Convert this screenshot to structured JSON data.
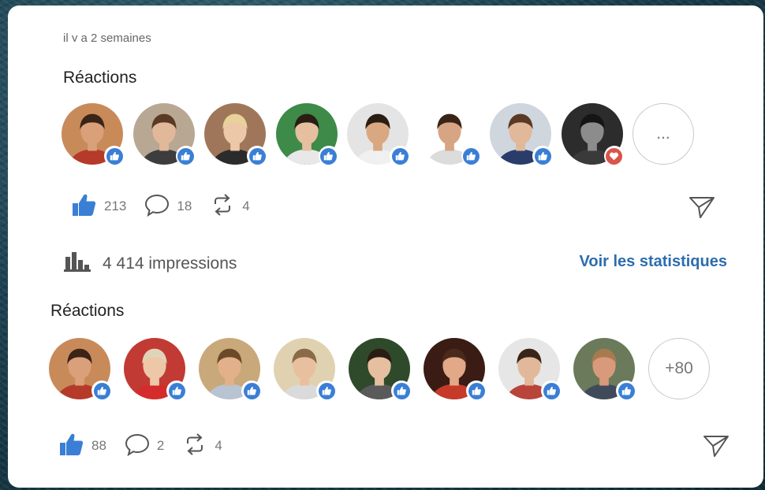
{
  "post1": {
    "timestamp": "il y a 2 semaines",
    "reactions_title": "Réactions",
    "avatars": [
      {
        "name": "avatar-1",
        "badge": "like",
        "bg": "#c98a5a",
        "skin": "#d9a07a",
        "hair": "#3a2418",
        "shirt": "#b53a2a"
      },
      {
        "name": "avatar-2",
        "badge": "like",
        "bg": "#b8a893",
        "skin": "#e2b89a",
        "hair": "#5a3a24",
        "shirt": "#3d3d3d"
      },
      {
        "name": "avatar-3",
        "badge": "like",
        "bg": "#a0765a",
        "skin": "#ecc7a8",
        "hair": "#e8d29a",
        "shirt": "#2b2b2b"
      },
      {
        "name": "avatar-4",
        "badge": "like",
        "bg": "#3e8a48",
        "skin": "#e5bfa0",
        "hair": "#2a1d14",
        "shirt": "#e8e8e8"
      },
      {
        "name": "avatar-5",
        "badge": "like",
        "bg": "#e4e4e4",
        "skin": "#d9a880",
        "hair": "#2a1d14",
        "shirt": "#f0f0f0"
      },
      {
        "name": "avatar-6",
        "badge": "like",
        "bg": "#ffffff",
        "skin": "#d8a584",
        "hair": "#3a2418",
        "shirt": "#dcdcdc"
      },
      {
        "name": "avatar-7",
        "badge": "like",
        "bg": "#d0d6de",
        "skin": "#e2b89a",
        "hair": "#5a3a24",
        "shirt": "#2a3d6a"
      },
      {
        "name": "avatar-8",
        "badge": "love",
        "bg": "#2c2c2c",
        "skin": "#8c8c8c",
        "hair": "#151515",
        "shirt": "#3a3a3a"
      }
    ],
    "more_label": "...",
    "likes": "213",
    "comments": "18",
    "reposts": "4"
  },
  "impressions": {
    "text": "4 414 impressions",
    "link": "Voir les statistiques"
  },
  "post2": {
    "reactions_title": "Réactions",
    "avatars": [
      {
        "name": "avatar-1",
        "badge": "like",
        "bg": "#c98a5a",
        "skin": "#d9a07a",
        "hair": "#3a2418",
        "shirt": "#b53a2a"
      },
      {
        "name": "avatar-2",
        "badge": "like",
        "bg": "#c23a34",
        "skin": "#ecc7a8",
        "hair": "#e0d4b8",
        "shirt": "#d42c2c"
      },
      {
        "name": "avatar-3",
        "badge": "like",
        "bg": "#c9a87a",
        "skin": "#e2b08a",
        "hair": "#6a4a28",
        "shirt": "#b8c4d2"
      },
      {
        "name": "avatar-4",
        "badge": "like",
        "bg": "#e0d2b0",
        "skin": "#e8c0a0",
        "hair": "#8a6a48",
        "shirt": "#dadada"
      },
      {
        "name": "avatar-5",
        "badge": "like",
        "bg": "#2f4a2a",
        "skin": "#e5bfa0",
        "hair": "#2a1d14",
        "shirt": "#5a5a5a"
      },
      {
        "name": "avatar-6",
        "badge": "like",
        "bg": "#3a1c14",
        "skin": "#e2a888",
        "hair": "#4a2a1a",
        "shirt": "#c63a2a"
      },
      {
        "name": "avatar-7",
        "badge": "like",
        "bg": "#e6e6e6",
        "skin": "#e2b89a",
        "hair": "#3a2418",
        "shirt": "#b8443a"
      },
      {
        "name": "avatar-8",
        "badge": "like",
        "bg": "#6a7a5a",
        "skin": "#d89a7a",
        "hair": "#a87a50",
        "shirt": "#404a5a"
      }
    ],
    "more_label": "+80",
    "likes": "88",
    "comments": "2",
    "reposts": "4"
  },
  "colors": {
    "like_blue": "#3a7fd5",
    "love_red": "#d9544a",
    "link_blue": "#2b6cb0"
  }
}
